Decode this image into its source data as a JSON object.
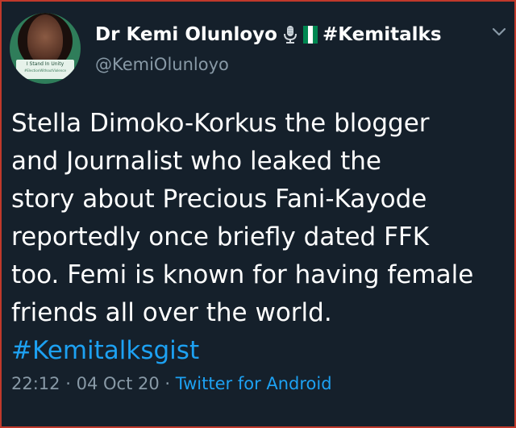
{
  "tweet": {
    "display_name": "Dr Kemi Olunloyo",
    "name_icons": [
      "microphone-icon",
      "nigeria-flag-icon"
    ],
    "name_hashtag": "#Kemitalks",
    "handle": "@KemiOlunloyo",
    "avatar_banner": "I Stand In Unity",
    "avatar_banner_sub": "#ElectionWithoutViolence",
    "text_lines": [
      "Stella Dimoko-Korkus the blogger",
      "and Journalist who leaked the",
      "story about Precious Fani-Kayode",
      "reportedly once briefly dated FFK",
      "too. Femi is known for having female",
      "friends all over the world."
    ],
    "hashtag": "#Kemitalksgist",
    "time": "22:12",
    "separator": "·",
    "date": "04 Oct 20",
    "source": "Twitter for Android"
  },
  "colors": {
    "background": "#15202b",
    "text": "#ffffff",
    "muted": "#8899a6",
    "link": "#1da1f2",
    "flag_green": "#008751",
    "frame_border": "#c0392b"
  }
}
